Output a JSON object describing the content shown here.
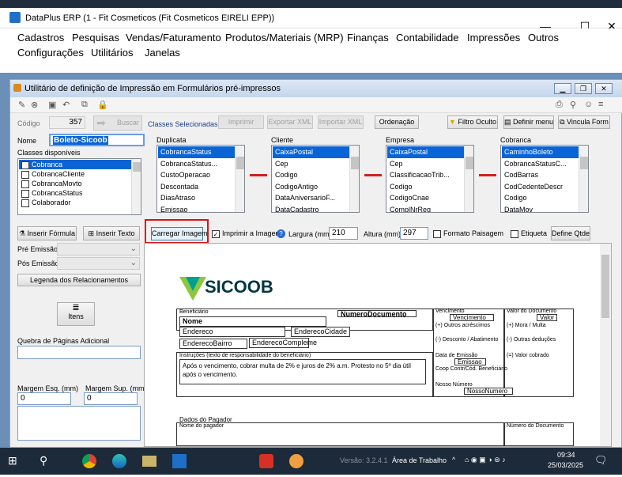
{
  "window": {
    "title": "DataPlus ERP (1 - Fit Cosmeticos  (Fit Cosmeticos EIRELI EPP))",
    "minimize": "—",
    "maximize": "☐",
    "close": "✕"
  },
  "menu": {
    "row1": [
      "Cadastros",
      "Pesquisas",
      "Vendas/Faturamento",
      "Produtos/Materiais (MRP)",
      "Finanças",
      "Contabilidade",
      "Impressões",
      "Outros"
    ],
    "row2": [
      "Configurações",
      "Utilitários",
      "Janelas"
    ]
  },
  "child": {
    "title": "Utilitário de definição de Impressão em Formulários pré-impressos",
    "codigo_label": "Código",
    "codigo_value": "357",
    "buscar": "Buscar",
    "nome_label": "Nome",
    "nome_value": "Boleto-Sicoob",
    "classes_disp_label": "Classes disponíveis",
    "classes_disp": [
      {
        "label": "Cobranca",
        "checked": true,
        "selected": true
      },
      {
        "label": "CobrancaCliente",
        "checked": false,
        "selected": false
      },
      {
        "label": "CobrancaMovto",
        "checked": false,
        "selected": false
      },
      {
        "label": "CobrancaStatus",
        "checked": false,
        "selected": false
      },
      {
        "label": "Colaborador",
        "checked": false,
        "selected": false
      }
    ],
    "classes_sel_label": "Classes Selecionadas",
    "top_buttons": {
      "imprimir": "Imprimir",
      "exportar": "Exportar XML",
      "importar": "Importar XML",
      "ordenacao": "Ordenação",
      "filtro": "Filtro Oculto",
      "definir_menu": "Definir menu",
      "vincula": "Vincula Form"
    },
    "groups": [
      {
        "name": "Duplicata",
        "items": [
          "CobrancaStatus",
          "CobrancaStatus...",
          "CustoOperacao",
          "Descontada",
          "DiasAtraso",
          "Emissao"
        ]
      },
      {
        "name": "Cliente",
        "items": [
          "CaixaPostal",
          "Cep",
          "Codigo",
          "CodigoAntigo",
          "DataAniversarioF...",
          "DataCadastro"
        ]
      },
      {
        "name": "Empresa",
        "items": [
          "CaixaPostal",
          "Cep",
          "ClassificacaoTrib...",
          "Codigo",
          "CodigoCnae",
          "ComplNrReg"
        ]
      },
      {
        "name": "Cobranca",
        "items": [
          "CaminhoBoleto",
          "CobrancaStatusC...",
          "CodBarras",
          "CodCedenteDescr",
          "Codigo",
          "DataMov"
        ]
      }
    ],
    "inserir_formula": "Inserir Fórmula",
    "inserir_texto": "Inserir Texto",
    "carregar_imagem": "Carregar Imagem",
    "imprimir_imagem": "Imprimir a Imagem",
    "largura_label": "Largura (mm):",
    "largura_value": "210",
    "altura_label": "Altura (mm):",
    "altura_value": "297",
    "formato_paisagem": "Formato Paisagem",
    "etiqueta": "Etiqueta",
    "define_qtde": "Define Qtde",
    "pre_emissao": "Pré Emissão",
    "pos_emissao": "Pós Emissão",
    "legenda": "Legenda dos Relacionamentos",
    "itens": "Itens",
    "quebra_label": "Quebra de Páginas Adicional",
    "margem_esq_label": "Margem Esq. (mm)",
    "margem_esq_value": "0",
    "margem_sup_label": "Margem Sup. (mm)",
    "margem_sup_value": "0"
  },
  "preview": {
    "logo_text": "SICOOB",
    "beneficiario": "Beneficiário",
    "numero_documento_top": "NumeroDocumento",
    "vencimento": "Vencimento",
    "vencimento_fld": "Vencimento",
    "valor_documento": "Valor do Documento",
    "valor_fld": "Valor",
    "outros_acrescimos": "(+) Outros acréscimos",
    "mora_multa": "(+) Mora / Multa",
    "desconto_abatimento": "(-) Desconto / Abatimento",
    "outras_deducoes": "(-) Outras deduções",
    "data_emissao": "Data de Emissão",
    "emissao_fld": "Emissao",
    "valor_cobrado": "(=) Valor cobrado",
    "coop_contrato": "Coop Contr/Cód. Beneficiário",
    "nosso_numero": "Nosso Número",
    "nosso_numero_fld": "NossoNumero",
    "nome_fld": "Nome",
    "endereco_fld": "Endereco",
    "endereco_cidade_fld": "EnderecoCidade",
    "endereco_bairro_fld": "EnderecoBairro",
    "endereco_compl_fld": "EnderecoCompleme",
    "instrucoes_label": "Instruções (texto de responsabilidade do beneficiário)",
    "instrucoes_text": "Após o vencimento, cobrar multa de 2% e juros de 2% a.m. Protesto no 5º dia útil após o vencimento.",
    "dados_pagador": "Dados do Pagador",
    "nome_pagador": "Nome do pagador",
    "numero_documento": "Número do Documento"
  },
  "taskbar": {
    "area_trabalho": "Área de Trabalho",
    "time": "09:34",
    "date": "25/03/2025",
    "versao": "Versão: 3.2.4.1"
  },
  "colors": {
    "selection": "#0a64d6",
    "mdi": "#6b8fb7",
    "highlight_box": "#e01010",
    "sicoob_green": "#8ec63f",
    "sicoob_teal": "#00a091"
  }
}
